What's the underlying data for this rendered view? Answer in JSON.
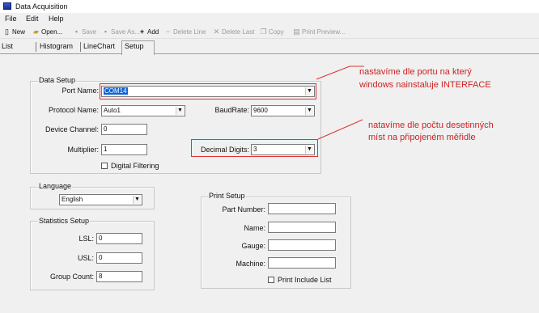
{
  "window": {
    "title": "Data Acquisition"
  },
  "menu": {
    "file": "File",
    "edit": "Edit",
    "help": "Help"
  },
  "toolbar": {
    "new": "New",
    "open": "Open...",
    "save": "Save",
    "save_as": "Save As...",
    "add": "Add",
    "delete_line": "Delete Line",
    "delete_last": "Delete Last",
    "copy": "Copy",
    "print_preview": "Print Preview..."
  },
  "tabs": [
    "List",
    "Histogram",
    "LineChart",
    "Setup"
  ],
  "data_setup": {
    "legend": "Data Setup",
    "port_name_label": "Port Name:",
    "port_name_value": "COM14",
    "protocol_label": "Protocol Name:",
    "protocol_value": "Auto1",
    "baudrate_label": "BaudRate:",
    "baudrate_value": "9600",
    "device_channel_label": "Device Channel:",
    "device_channel_value": "0",
    "multiplier_label": "Multiplier:",
    "multiplier_value": "1",
    "decimal_digits_label": "Decimal Digits:",
    "decimal_digits_value": "3",
    "digital_filtering_label": "Digital Filtering"
  },
  "language": {
    "legend": "Language",
    "value": "English"
  },
  "statistics": {
    "legend": "Statistics Setup",
    "lsl_label": "LSL:",
    "lsl_value": "0",
    "usl_label": "USL:",
    "usl_value": "0",
    "group_count_label": "Group Count:",
    "group_count_value": "8"
  },
  "print_setup": {
    "legend": "Print Setup",
    "part_number_label": "Part Number:",
    "part_number_value": "",
    "name_label": "Name:",
    "name_value": "",
    "gauge_label": "Gauge:",
    "gauge_value": "",
    "machine_label": "Machine:",
    "machine_value": "",
    "print_include_list_label": "Print Include List"
  },
  "annotations": {
    "port_note_line1": "nastavíme dle portu na který",
    "port_note_line2": "windows nainstaluje INTERFACE",
    "digits_note_line1": "natavíme dle počtu desetinných",
    "digits_note_line2": "míst na připojeném měřidle"
  },
  "colors": {
    "annotation_red": "#cc2222",
    "selection_blue": "#0a64d8"
  }
}
